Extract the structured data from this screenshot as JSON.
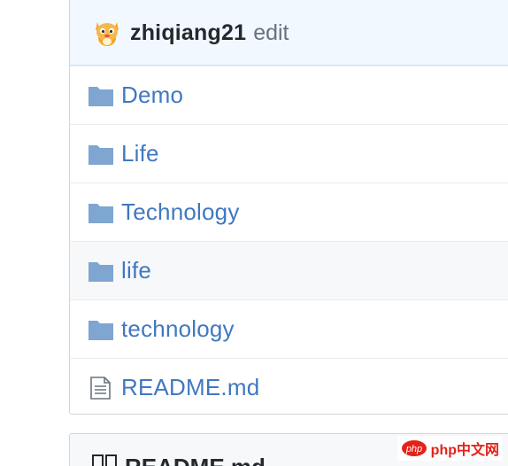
{
  "commit": {
    "author": "zhiqiang21",
    "edit_label": "edit"
  },
  "files": [
    {
      "name": "Demo",
      "type": "folder"
    },
    {
      "name": "Life",
      "type": "folder"
    },
    {
      "name": "Technology",
      "type": "folder"
    },
    {
      "name": "life",
      "type": "folder"
    },
    {
      "name": "technology",
      "type": "folder"
    },
    {
      "name": "README.md",
      "type": "file"
    }
  ],
  "readme": {
    "title": "README.md"
  },
  "watermark": {
    "text": "php中文网"
  },
  "colors": {
    "link": "#4078c0",
    "folder": "#7fa5d1",
    "header_bg": "#f1f8ff",
    "hover_row": "#f6f8fa"
  }
}
